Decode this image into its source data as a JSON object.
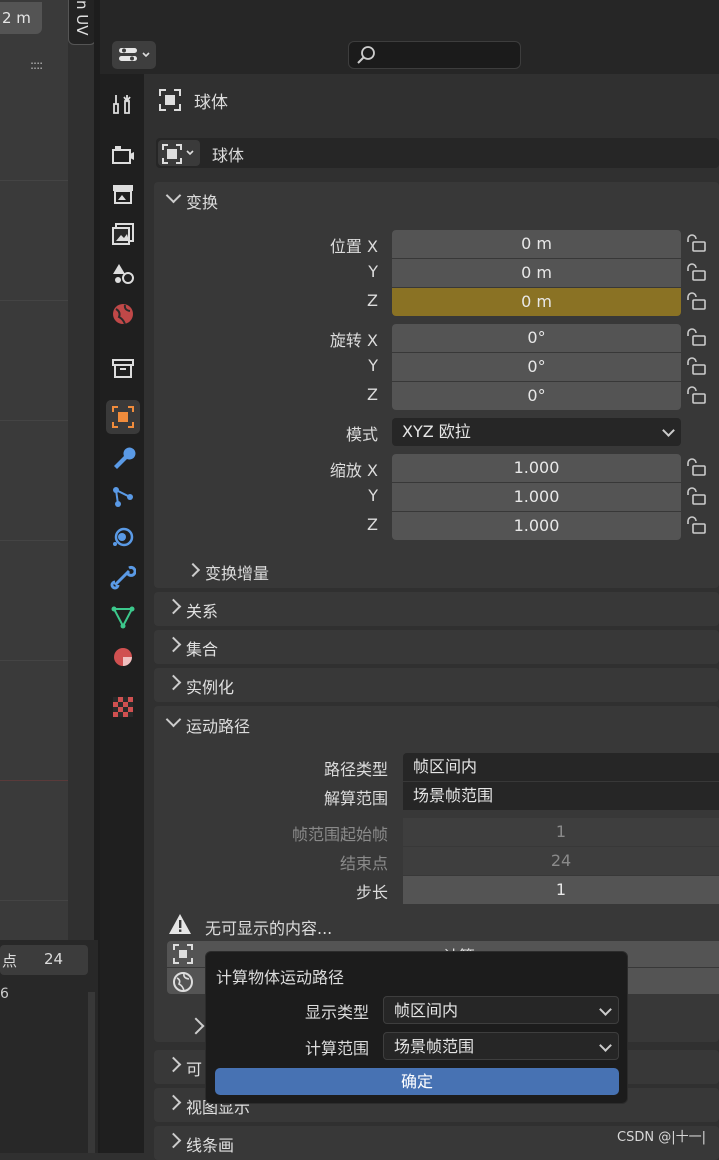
{
  "viewport": {
    "badge": "2 m",
    "grip": "::::",
    "tab_label": "n UV"
  },
  "timeline": {
    "label": "点",
    "value": "24",
    "sub_value": "6"
  },
  "object": {
    "name": "球体",
    "datablock_name": "球体"
  },
  "transform": {
    "title": "变换",
    "location_label": "位置",
    "rotation_label": "旋转",
    "scale_label": "缩放",
    "axes": [
      "X",
      "Y",
      "Z"
    ],
    "location": [
      "0 m",
      "0 m",
      "0 m"
    ],
    "rotation": [
      "0°",
      "0°",
      "0°"
    ],
    "mode_label": "模式",
    "mode_value": "XYZ 欧拉",
    "scale": [
      "1.000",
      "1.000",
      "1.000"
    ],
    "delta_title": "变换增量"
  },
  "sections": {
    "relations": "关系",
    "collections": "集合",
    "instancing": "实例化",
    "motion_paths": "运动路径",
    "visibility": "可",
    "viewport_display": "视图显示",
    "line_art": "线条画"
  },
  "motion_paths": {
    "path_type_label": "路径类型",
    "path_type_value": "帧区间内",
    "range_label": "解算范围",
    "range_value": "场景帧范围",
    "frame_start_label": "帧范围起始帧",
    "frame_start_value": "1",
    "end_label": "结束点",
    "end_value": "24",
    "step_label": "步长",
    "step_value": "1",
    "warning": "无可显示的内容...",
    "calculate_label": "计算"
  },
  "popup": {
    "title": "计算物体运动路径",
    "display_type_label": "显示类型",
    "display_type_value": "帧区间内",
    "range_label": "计算范围",
    "range_value": "场景帧范围",
    "ok_label": "确定"
  },
  "watermark": "CSDN @|十一|",
  "colors": {
    "accent_field": "#8a7224",
    "ok_button": "#4772b3",
    "object_tab": "#f08c3c"
  }
}
